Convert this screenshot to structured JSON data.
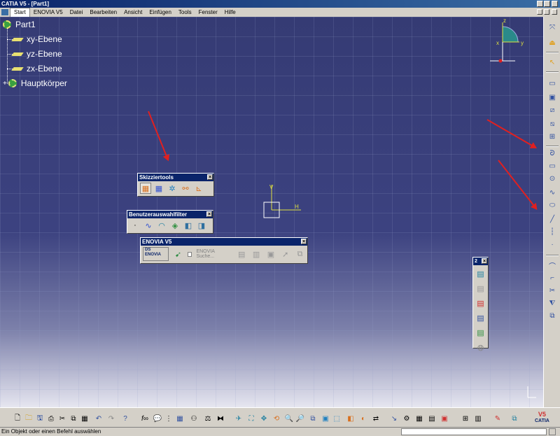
{
  "window": {
    "title": "CATIA V5 - [Part1]"
  },
  "menu": {
    "items": [
      "Start",
      "ENOVIA V5",
      "Datei",
      "Bearbeiten",
      "Ansicht",
      "Einfügen",
      "Tools",
      "Fenster",
      "Hilfe"
    ]
  },
  "tree": {
    "root": "Part1",
    "planes": [
      "xy-Ebene",
      "yz-Ebene",
      "zx-Ebene"
    ],
    "body": "Hauptkörper"
  },
  "compass": {
    "axes": [
      "z",
      "x",
      "y"
    ]
  },
  "sketch_axes": {
    "v": "V",
    "h": "H"
  },
  "toolbars": {
    "sketch_tools": {
      "title": "Skizziertools",
      "close": "×"
    },
    "selection_filter": {
      "title": "Benutzerauswahlfilter",
      "close": "×"
    },
    "enovia": {
      "title": "ENOVIA V5",
      "close": "×",
      "search": "ENOVIA Suche...",
      "logo": "ENOVIA",
      "brand": "DS"
    },
    "small_panel": {
      "title": "2",
      "close": "×"
    }
  },
  "brand": {
    "catia": "CATIA",
    "v5": "V5"
  },
  "status": {
    "message": "Ein Objekt oder einen Befehl auswählen"
  },
  "colors": {
    "viewport_top": "#353b74",
    "viewport_bottom": "#e6e6f0",
    "annotation_arrow": "#e02020",
    "title_bar": "#0a246a"
  }
}
